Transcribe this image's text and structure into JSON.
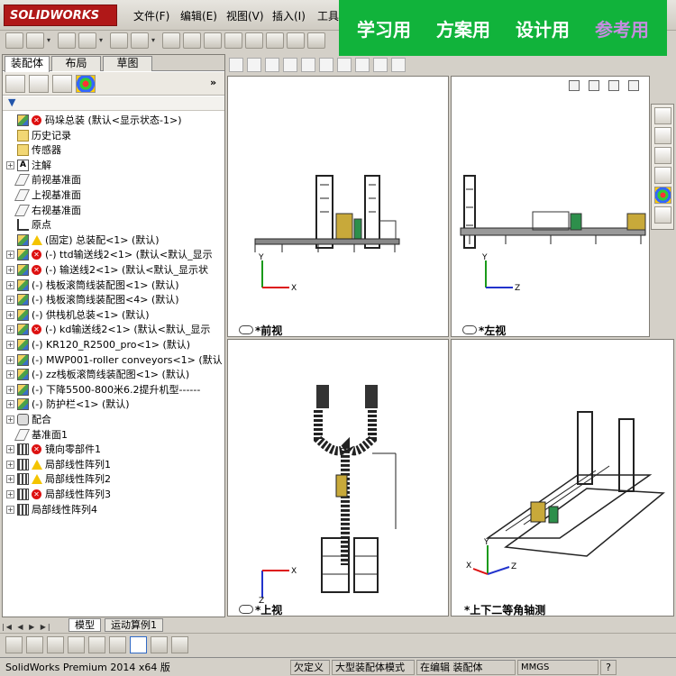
{
  "app": {
    "brand": "SOLIDWORKS"
  },
  "menu": [
    "文件(F)",
    "编辑(E)",
    "视图(V)",
    "插入(I)",
    "工具"
  ],
  "banner": [
    "学习用",
    "方案用",
    "设计用",
    "参考用"
  ],
  "panel_tabs": [
    "装配体",
    "布局",
    "草图"
  ],
  "panel_collapse": "»",
  "tree": [
    {
      "label": "码垛总装  (默认<显示状态-1>)",
      "status": "err",
      "icon": "part",
      "indent": 0
    },
    {
      "label": "历史记录",
      "icon": "folder",
      "indent": 1
    },
    {
      "label": "传感器",
      "icon": "folder",
      "indent": 1
    },
    {
      "label": "注解",
      "icon": "text",
      "indent": 1,
      "expand": true
    },
    {
      "label": "前视基准面",
      "icon": "plane",
      "indent": 1
    },
    {
      "label": "上视基准面",
      "icon": "plane",
      "indent": 1
    },
    {
      "label": "右视基准面",
      "icon": "plane",
      "indent": 1
    },
    {
      "label": "原点",
      "icon": "origin",
      "indent": 1
    },
    {
      "label": "(固定) 总装配<1> (默认)",
      "status": "warn",
      "icon": "part",
      "indent": 1
    },
    {
      "label": "(-) ttd输送线2<1> (默认<默认_显示",
      "status": "err",
      "icon": "part",
      "indent": 1,
      "expand": true
    },
    {
      "label": "(-) 输送线2<1> (默认<默认_显示状",
      "status": "err",
      "icon": "part",
      "indent": 1,
      "expand": true
    },
    {
      "label": "(-) 栈板滚筒线装配图<1> (默认)",
      "icon": "part",
      "indent": 1,
      "expand": true
    },
    {
      "label": "(-) 栈板滚筒线装配图<4> (默认)",
      "icon": "part",
      "indent": 1,
      "expand": true
    },
    {
      "label": "(-) 供栈机总装<1> (默认)",
      "icon": "part",
      "indent": 1,
      "expand": true
    },
    {
      "label": "(-) kd输送线2<1> (默认<默认_显示",
      "status": "err",
      "icon": "part",
      "indent": 1,
      "expand": true
    },
    {
      "label": "(-) KR120_R2500_pro<1> (默认)",
      "icon": "part",
      "indent": 1,
      "expand": true
    },
    {
      "label": "(-) MWP001-roller conveyors<1> (默认",
      "icon": "part",
      "indent": 1,
      "expand": true
    },
    {
      "label": "(-) zz栈板滚筒线装配图<1> (默认)",
      "icon": "part",
      "indent": 1,
      "expand": true
    },
    {
      "label": "(-) 下降5500-800米6.2提升机型------",
      "icon": "part",
      "indent": 1,
      "expand": true
    },
    {
      "label": "(-) 防护栏<1> (默认)",
      "icon": "part",
      "indent": 1,
      "expand": true
    },
    {
      "label": "配合",
      "icon": "mate",
      "indent": 1,
      "expand": true
    },
    {
      "label": "基准面1",
      "icon": "plane",
      "indent": 1
    },
    {
      "label": "镜向零部件1",
      "status": "err",
      "icon": "pattern",
      "indent": 1,
      "expand": true
    },
    {
      "label": "局部线性阵列1",
      "status": "warn",
      "icon": "pattern",
      "indent": 1,
      "expand": true
    },
    {
      "label": "局部线性阵列2",
      "status": "warn",
      "icon": "pattern",
      "indent": 1,
      "expand": true
    },
    {
      "label": "局部线性阵列3",
      "status": "err",
      "icon": "pattern",
      "indent": 1,
      "expand": true
    },
    {
      "label": "局部线性阵列4",
      "icon": "pattern",
      "indent": 1,
      "expand": true
    }
  ],
  "views": {
    "front": "*前视",
    "left": "*左视",
    "top": "*上视",
    "iso": "*上下二等角轴测"
  },
  "axes": {
    "x": "X",
    "y": "Y",
    "z": "Z"
  },
  "bottom_tabs": [
    "模型",
    "运动算例1"
  ],
  "status": {
    "product": "SolidWorks Premium 2014 x64 版",
    "under_defined": "欠定义",
    "large_mode": "大型装配体模式",
    "editing": "在编辑 装配体",
    "units": "MMGS",
    "help": "?"
  },
  "colors": {
    "banner_bg": "#11b33b",
    "brand_red": "#b01818",
    "axis_x": "#d11",
    "axis_y": "#1a9a1a",
    "axis_z": "#2233cc"
  }
}
